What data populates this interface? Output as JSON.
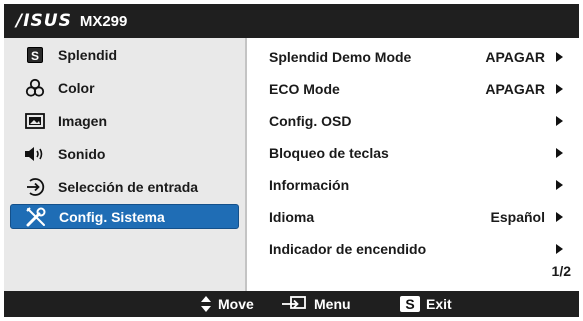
{
  "header": {
    "brand": "/ISUS",
    "model": "MX299"
  },
  "sidebar": {
    "items": [
      {
        "label": "Splendid",
        "icon": "splendid-s-icon",
        "selected": false
      },
      {
        "label": "Color",
        "icon": "color-circles-icon",
        "selected": false
      },
      {
        "label": "Imagen",
        "icon": "image-icon",
        "selected": false
      },
      {
        "label": "Sonido",
        "icon": "speaker-icon",
        "selected": false
      },
      {
        "label": "Selección de entrada",
        "icon": "input-arrow-icon",
        "selected": false
      },
      {
        "label": "Config. Sistema",
        "icon": "tools-icon",
        "selected": true
      }
    ]
  },
  "settings": {
    "rows": [
      {
        "label": "Splendid Demo Mode",
        "value": "APAGAR",
        "arrow": true
      },
      {
        "label": "ECO Mode",
        "value": "APAGAR",
        "arrow": true
      },
      {
        "label": "Config. OSD",
        "value": "",
        "arrow": true
      },
      {
        "label": "Bloqueo de teclas",
        "value": "",
        "arrow": true
      },
      {
        "label": "Información",
        "value": "",
        "arrow": true
      },
      {
        "label": "Idioma",
        "value": "Español",
        "arrow": true
      },
      {
        "label": "Indicador de encendido",
        "value": "",
        "arrow": true
      }
    ],
    "page": "1/2"
  },
  "footer": {
    "move_label": "Move",
    "menu_label": "Menu",
    "exit_label": "Exit",
    "exit_key": "S"
  },
  "icons": {
    "splendid_key": "S"
  },
  "colors": {
    "selected_bg": "#1f6db5",
    "bar_bg": "#1f1f1f",
    "sidebar_bg": "#e9e9e9"
  }
}
